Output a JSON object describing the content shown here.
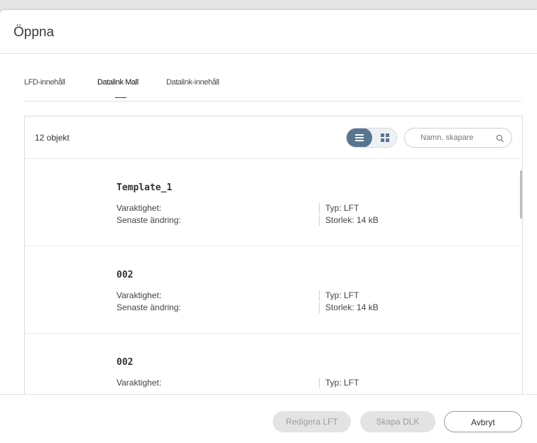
{
  "dialog": {
    "title": "Öppna"
  },
  "tabs": [
    {
      "label": "LFD-innehåll",
      "active": false
    },
    {
      "label": "Datalink Mall",
      "active": true
    },
    {
      "label": "Datalink-innehåll",
      "active": false
    }
  ],
  "toolbar": {
    "count_label": "12 objekt",
    "view_list_icon": "list-view-icon",
    "view_grid_icon": "grid-view-icon",
    "search_placeholder": "Namn, skapare",
    "search_icon": "search-icon"
  },
  "items": [
    {
      "name": "Template_1",
      "duration_label": "Varaktighet:",
      "modified_label": "Senaste ändring:",
      "type_label": "Typ: LFT",
      "size_label": "Storlek: 14 kB"
    },
    {
      "name": "002",
      "duration_label": "Varaktighet:",
      "modified_label": "Senaste ändring:",
      "type_label": "Typ: LFT",
      "size_label": "Storlek: 14 kB"
    },
    {
      "name": "002",
      "duration_label": "Varaktighet:",
      "modified_label": "",
      "type_label": "Typ: LFT",
      "size_label": ""
    }
  ],
  "footer": {
    "edit_label": "Redigera LFT",
    "create_label": "Skapa DLK",
    "cancel_label": "Avbryt"
  },
  "colors": {
    "accent": "#587590",
    "disabled_button": "#e3e3e3",
    "disabled_text": "#9c9c9c"
  }
}
